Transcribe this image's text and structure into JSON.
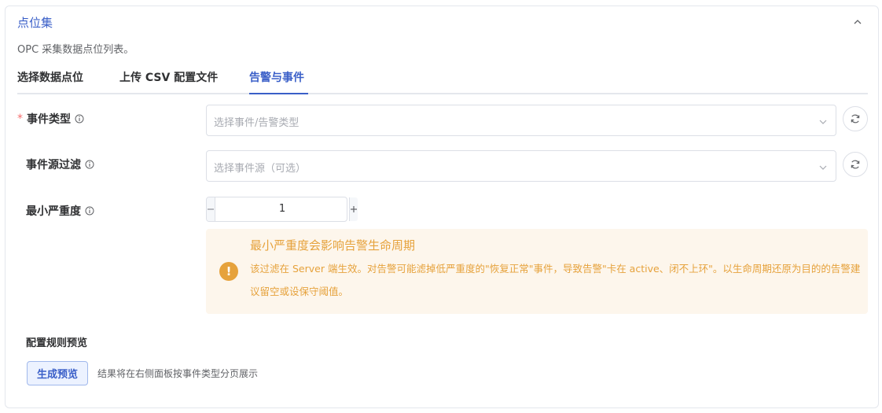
{
  "panel": {
    "title": "点位集",
    "description": "OPC 采集数据点位列表。"
  },
  "tabs": [
    {
      "label": "选择数据点位",
      "active": false
    },
    {
      "label": "上传 CSV 配置文件",
      "active": false
    },
    {
      "label": "告警与事件",
      "active": true
    }
  ],
  "form": {
    "event_type": {
      "required_mark": "*",
      "label": "事件类型",
      "placeholder": "选择事件/告警类型"
    },
    "event_source": {
      "label": "事件源过滤",
      "placeholder": "选择事件源（可选）"
    },
    "min_severity": {
      "label": "最小严重度",
      "value": "1"
    }
  },
  "alert": {
    "title": "最小严重度会影响告警生命周期",
    "text": "该过滤在 Server 端生效。对告警可能滤掉低严重度的\"恢复正常\"事件，导致告警\"卡在 active、闭不上环\"。以生命周期还原为目的的告警建议留空或设保守阈值。"
  },
  "preview": {
    "section_title": "配置规则预览",
    "button_label": "生成预览",
    "hint": "结果将在右侧面板按事件类型分页展示"
  },
  "colors": {
    "accent": "#3a5fc8",
    "warning": "#e6a23c",
    "warning_bg": "#fdf6ec",
    "required": "#f56c6c"
  },
  "icons": {
    "collapse": "chevron-up-icon",
    "info": "info-circle-icon",
    "select_arrow": "chevron-down-icon",
    "refresh": "refresh-icon",
    "warning": "exclamation-circle-icon"
  }
}
